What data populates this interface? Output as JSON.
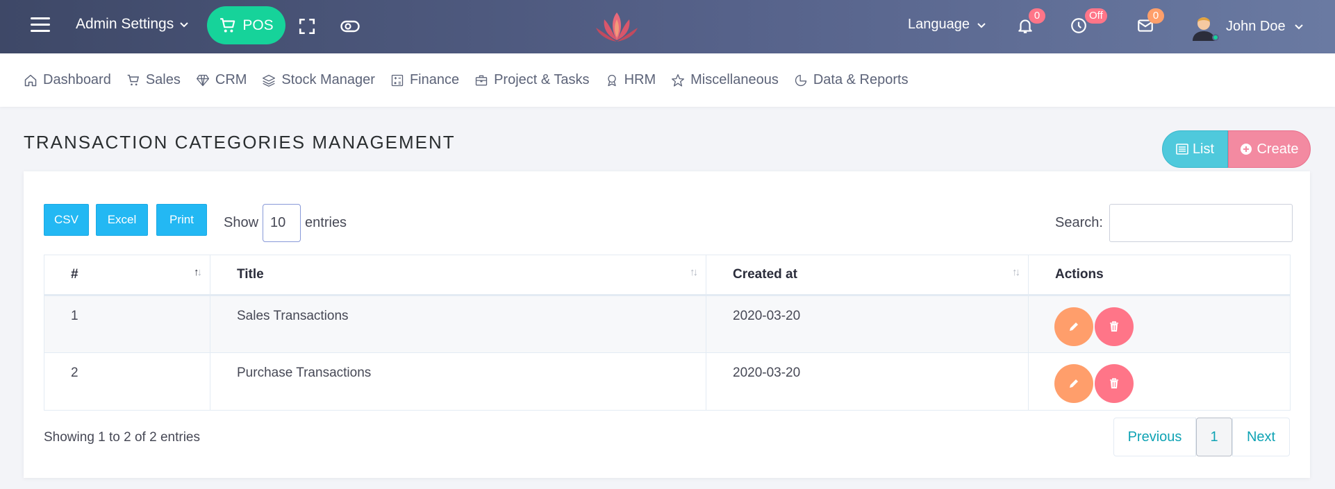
{
  "header": {
    "admin_menu_label": "Admin Settings",
    "pos_label": "POS",
    "language_label": "Language",
    "notifications_count": "0",
    "clock_status": "Off",
    "messages_count": "0",
    "user_name": "John Doe"
  },
  "nav": {
    "items": [
      {
        "label": "Dashboard",
        "icon": "home-icon"
      },
      {
        "label": "Sales",
        "icon": "cart-icon"
      },
      {
        "label": "CRM",
        "icon": "diamond-icon"
      },
      {
        "label": "Stock Manager",
        "icon": "layers-icon"
      },
      {
        "label": "Finance",
        "icon": "calculator-icon"
      },
      {
        "label": "Project & Tasks",
        "icon": "briefcase-icon"
      },
      {
        "label": "HRM",
        "icon": "award-icon"
      },
      {
        "label": "Miscellaneous",
        "icon": "star-icon"
      },
      {
        "label": "Data & Reports",
        "icon": "pie-chart-icon"
      }
    ]
  },
  "page": {
    "title": "TRANSACTION CATEGORIES MANAGEMENT",
    "list_button": "List",
    "create_button": "Create"
  },
  "table_controls": {
    "csv": "CSV",
    "excel": "Excel",
    "print": "Print",
    "show_label": "Show",
    "entries_value": "10",
    "entries_label": "entries",
    "search_label": "Search:",
    "search_value": ""
  },
  "table": {
    "headers": [
      "#",
      "Title",
      "Created at",
      "Actions"
    ],
    "rows": [
      {
        "num": "1",
        "title": "Sales Transactions",
        "created_at": "2020-03-20"
      },
      {
        "num": "2",
        "title": "Purchase Transactions",
        "created_at": "2020-03-20"
      }
    ]
  },
  "footer": {
    "info": "Showing 1 to 2 of 2 entries",
    "previous": "Previous",
    "page": "1",
    "next": "Next"
  },
  "colors": {
    "pos_green": "#16d39a",
    "info_blue": "#23b8f3",
    "list_cyan": "#4fc9dc",
    "create_pink": "#f38aa1",
    "edit_orange": "#ff9e6b",
    "delete_red": "#ff7588",
    "link_teal": "#0fa3b4"
  }
}
